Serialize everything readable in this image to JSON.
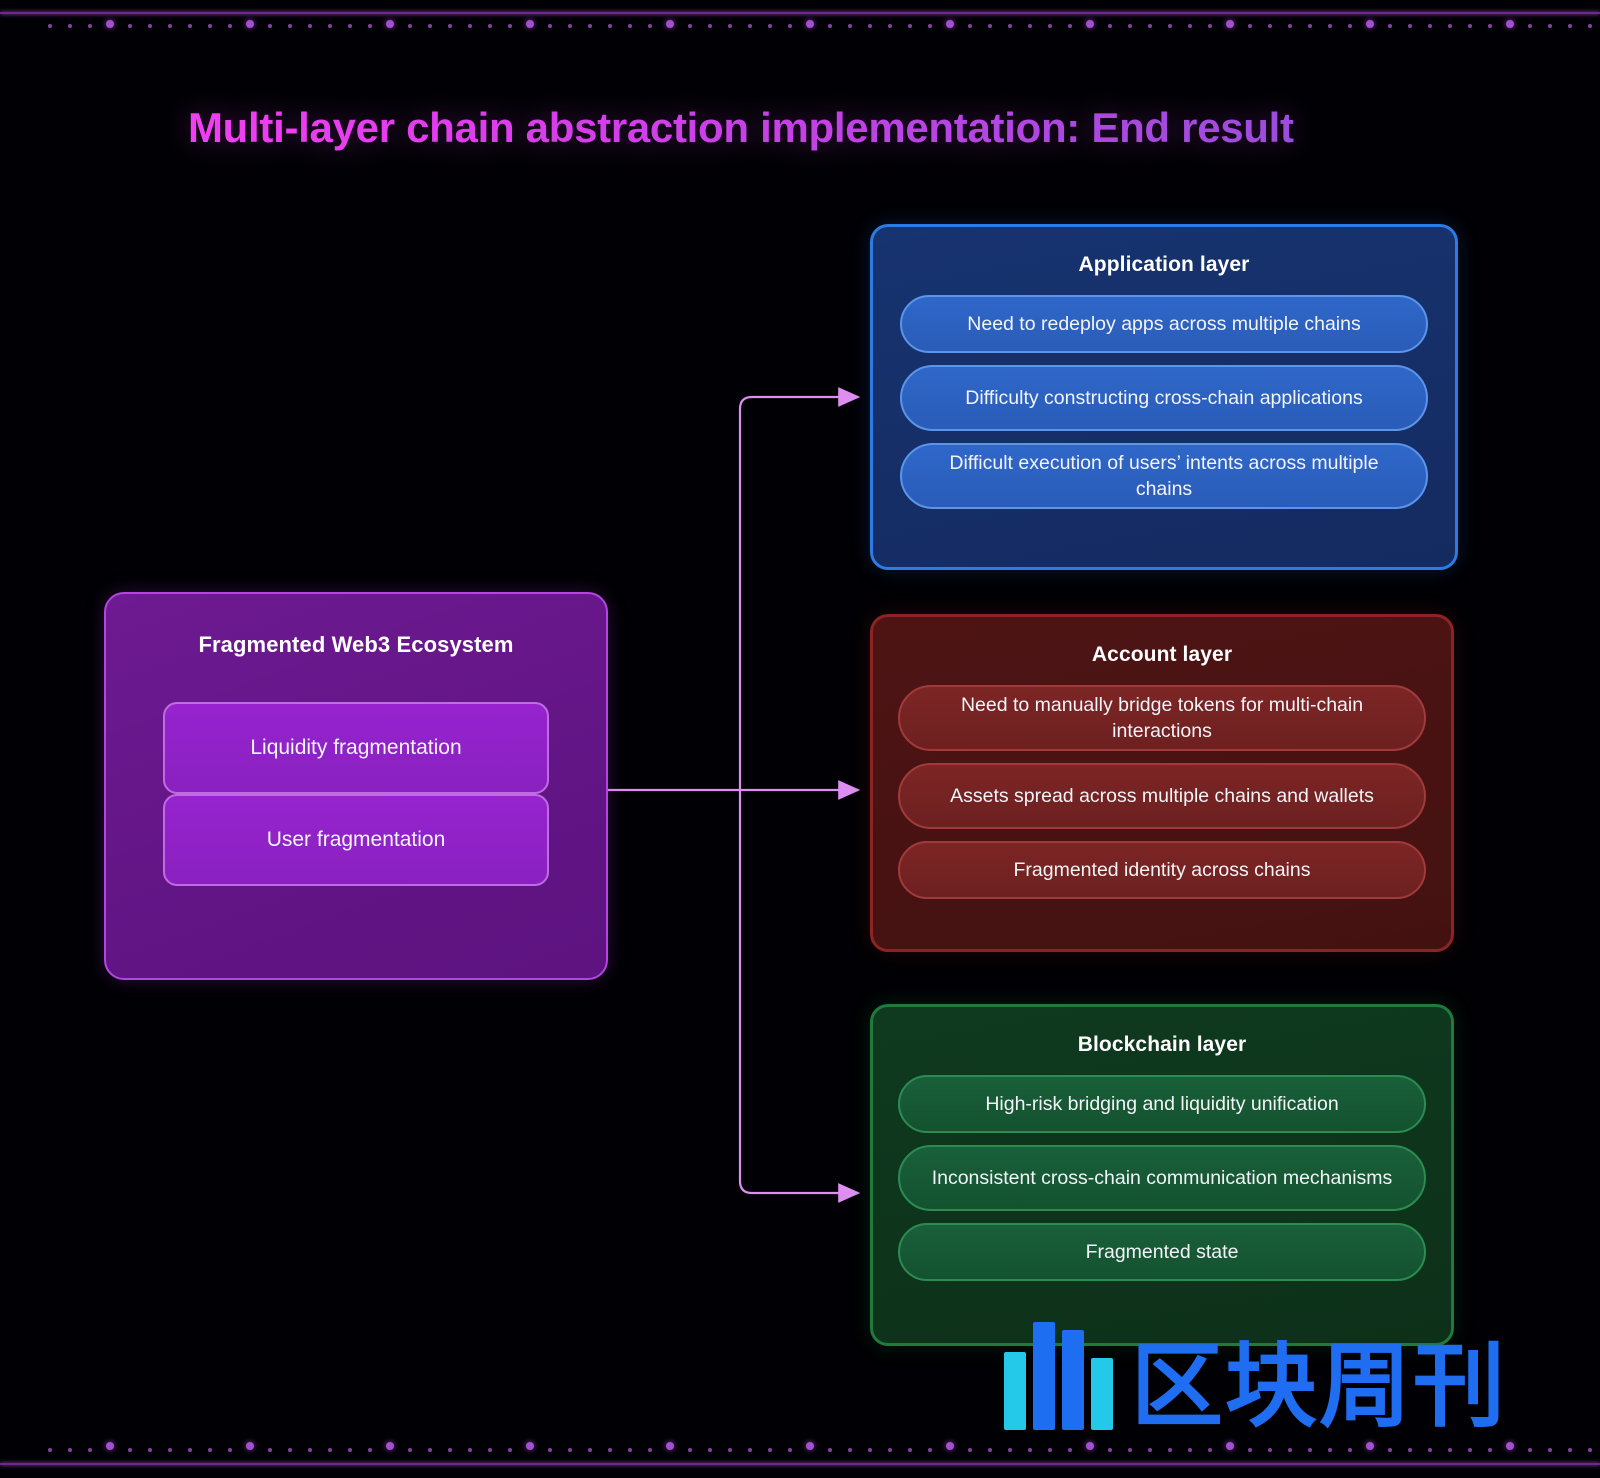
{
  "page": {
    "title": "Multi-layer chain abstraction implementation: End result",
    "background_color": "#010004",
    "accent_color": "#b24fd8"
  },
  "ecosystem": {
    "title": "Fragmented Web3 Ecosystem",
    "color": "#8e22c4",
    "items": [
      {
        "label": "Liquidity fragmentation"
      },
      {
        "label": "User fragmentation"
      }
    ]
  },
  "layers": [
    {
      "id": "application",
      "title": "Application layer",
      "color": "#2b7ce4",
      "items": [
        {
          "label": "Need to redeploy apps across multiple chains"
        },
        {
          "label": "Difficulty constructing cross-chain applications"
        },
        {
          "label": "Difficult execution of users’ intents across multiple chains"
        }
      ]
    },
    {
      "id": "account",
      "title": "Account layer",
      "color": "#8e2323",
      "items": [
        {
          "label": "Need to manually bridge tokens for multi-chain interactions"
        },
        {
          "label": "Assets spread across multiple chains and wallets"
        },
        {
          "label": "Fragmented identity across chains"
        }
      ]
    },
    {
      "id": "blockchain",
      "title": "Blockchain layer",
      "color": "#1f7a3c",
      "items": [
        {
          "label": "High-risk bridging and liquidity unification"
        },
        {
          "label": "Inconsistent cross-chain communication mechanisms"
        },
        {
          "label": "Fragmented state"
        }
      ]
    }
  ],
  "connectors": {
    "color": "#dd8ef0",
    "arrow_targets": [
      "Application layer",
      "Account layer",
      "Blockchain layer"
    ]
  },
  "watermark": {
    "text": "区块周刊",
    "logo_color": "#1d6ef0",
    "logo_accent": "#24c8e8"
  }
}
